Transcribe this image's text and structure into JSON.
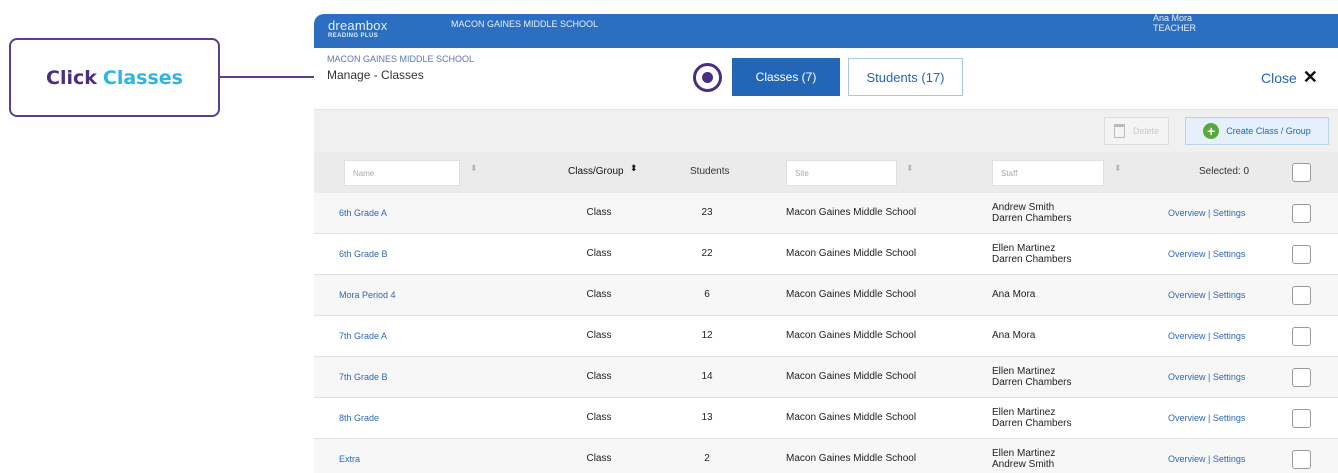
{
  "callout": {
    "prefix": "Click",
    "highlight": "Classes"
  },
  "topbar": {
    "logo_main": "dreambox",
    "logo_sub": "READING PLUS",
    "school": "MACON GAINES MIDDLE SCHOOL",
    "user_name": "Ana Mora",
    "user_role": "TEACHER"
  },
  "header": {
    "breadcrumb_school": "MACON GAINES MIDDLE SCHOOL",
    "title": "Manage - Classes",
    "tabs": [
      {
        "label": "Classes (7)",
        "active": true
      },
      {
        "label": "Students (17)",
        "active": false
      }
    ],
    "close_label": "Close",
    "close_glyph": "✕"
  },
  "toolbar": {
    "delete_label": "Delete",
    "create_label": "Create Class / Group",
    "create_glyph": "+"
  },
  "table": {
    "filters": {
      "name": "Name",
      "site": "Site",
      "staff": "Staff"
    },
    "headers": {
      "class_group": "Class/Group",
      "students": "Students",
      "selected": "Selected: 0"
    },
    "sort_glyph": "⬍",
    "sort_glyph_active": "⬍",
    "rows": [
      {
        "name": "6th Grade A",
        "type": "Class",
        "students": "23",
        "site": "Macon Gaines Middle School",
        "staff1": "Andrew Smith",
        "staff2": "Darren Chambers",
        "links": "Overview | Settings"
      },
      {
        "name": "6th Grade B",
        "type": "Class",
        "students": "22",
        "site": "Macon Gaines Middle School",
        "staff1": "Ellen Martinez",
        "staff2": "Darren Chambers",
        "links": "Overview | Settings"
      },
      {
        "name": "Mora Period 4",
        "type": "Class",
        "students": "6",
        "site": "Macon Gaines Middle School",
        "staff1": "Ana Mora",
        "staff2": "",
        "links": "Overview | Settings"
      },
      {
        "name": "7th Grade A",
        "type": "Class",
        "students": "12",
        "site": "Macon Gaines Middle School",
        "staff1": "Ana Mora",
        "staff2": "",
        "links": "Overview | Settings"
      },
      {
        "name": "7th Grade B",
        "type": "Class",
        "students": "14",
        "site": "Macon Gaines Middle School",
        "staff1": "Ellen Martinez",
        "staff2": "Darren Chambers",
        "links": "Overview | Settings"
      },
      {
        "name": "8th Grade",
        "type": "Class",
        "students": "13",
        "site": "Macon Gaines Middle School",
        "staff1": "Ellen Martinez",
        "staff2": "Darren Chambers",
        "links": "Overview | Settings"
      },
      {
        "name": "Extra",
        "type": "Class",
        "students": "2",
        "site": "Macon Gaines Middle School",
        "staff1": "Ellen Martinez",
        "staff2": "Andrew Smith",
        "links": "Overview | Settings"
      }
    ]
  },
  "colors": {
    "brand": "#2c6ec0",
    "callout_border": "#5b3e8c",
    "callout_highlight": "#2bb5e8",
    "create_icon": "#58a83a"
  }
}
